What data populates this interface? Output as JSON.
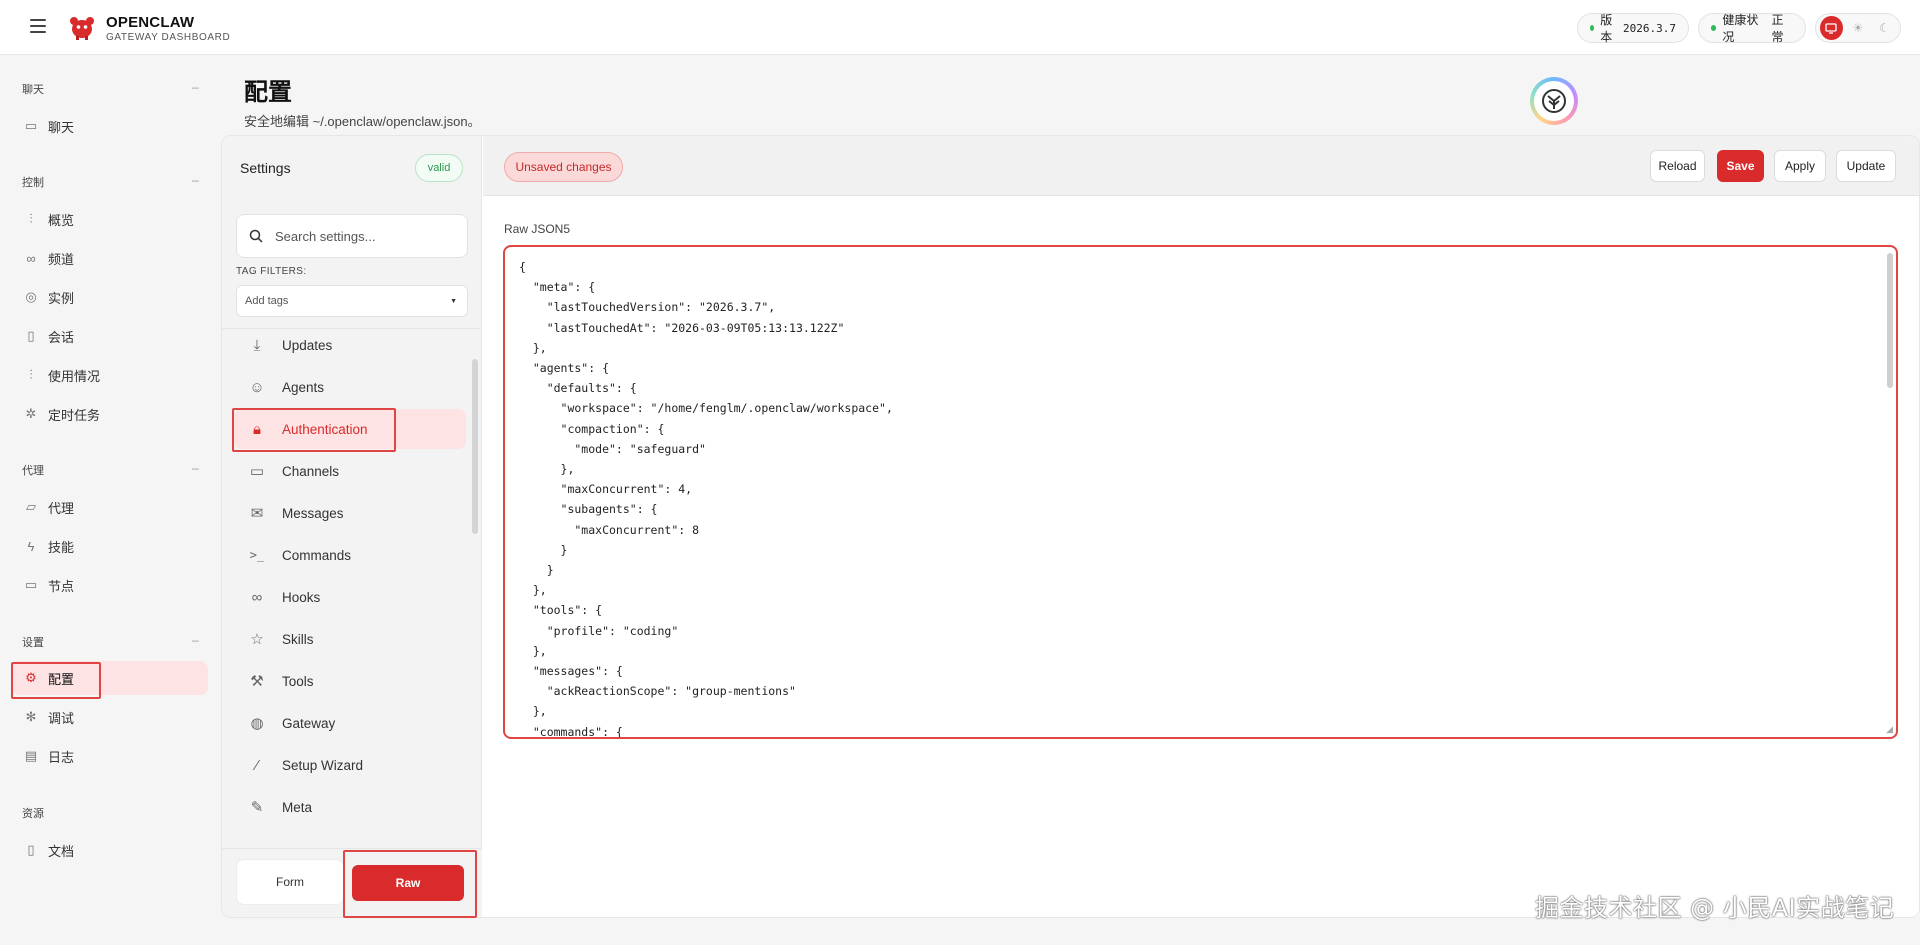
{
  "header": {
    "brand_name": "OPENCLAW",
    "brand_sub": "GATEWAY DASHBOARD",
    "version_label": "版本",
    "version_value": "2026.3.7",
    "health_label": "健康状况",
    "health_value": "正常",
    "status_color": "#2ebc5a",
    "accent_color": "#d92b2b"
  },
  "nav": {
    "sections": [
      {
        "label": "聊天",
        "collapse": "–",
        "items": [
          {
            "label": "聊天",
            "icon": "chat-icon"
          }
        ]
      },
      {
        "label": "控制",
        "collapse": "–",
        "items": [
          {
            "label": "概览",
            "icon": "bar-chart-icon"
          },
          {
            "label": "频道",
            "icon": "link-icon"
          },
          {
            "label": "实例",
            "icon": "broadcast-icon"
          },
          {
            "label": "会话",
            "icon": "document-icon"
          },
          {
            "label": "使用情况",
            "icon": "bar-chart-icon"
          },
          {
            "label": "定时任务",
            "icon": "spinner-icon"
          }
        ]
      },
      {
        "label": "代理",
        "collapse": "–",
        "items": [
          {
            "label": "代理",
            "icon": "folder-icon"
          },
          {
            "label": "技能",
            "icon": "bolt-icon"
          },
          {
            "label": "节点",
            "icon": "monitor-icon"
          }
        ]
      },
      {
        "label": "设置",
        "collapse": "–",
        "items": [
          {
            "label": "配置",
            "icon": "gear-icon",
            "active": true
          },
          {
            "label": "调试",
            "icon": "bug-icon"
          },
          {
            "label": "日志",
            "icon": "log-icon"
          }
        ]
      },
      {
        "label": "资源",
        "items": [
          {
            "label": "文档",
            "icon": "book-icon"
          }
        ]
      }
    ]
  },
  "page": {
    "title": "配置",
    "subtitle": "安全地编辑 ~/.openclaw/openclaw.json。"
  },
  "settings": {
    "title": "Settings",
    "valid_badge": "valid",
    "search_placeholder": "Search settings...",
    "tag_filters_label": "TAG FILTERS:",
    "tag_select_value": "Add tags",
    "categories": [
      {
        "label": "Updates",
        "icon": "download-icon"
      },
      {
        "label": "Agents",
        "icon": "robot-icon"
      },
      {
        "label": "Authentication",
        "icon": "lock-icon",
        "active": true
      },
      {
        "label": "Channels",
        "icon": "chat-icon"
      },
      {
        "label": "Messages",
        "icon": "mail-icon"
      },
      {
        "label": "Commands",
        "icon": "terminal-icon"
      },
      {
        "label": "Hooks",
        "icon": "link-icon"
      },
      {
        "label": "Skills",
        "icon": "star-icon"
      },
      {
        "label": "Tools",
        "icon": "wrench-icon"
      },
      {
        "label": "Gateway",
        "icon": "globe-icon"
      },
      {
        "label": "Setup Wizard",
        "icon": "wand-icon"
      },
      {
        "label": "Meta",
        "icon": "pencil-icon"
      }
    ],
    "mode_form": "Form",
    "mode_raw": "Raw"
  },
  "editor": {
    "unsaved_label": "Unsaved changes",
    "reload": "Reload",
    "save": "Save",
    "apply": "Apply",
    "update": "Update",
    "raw_label": "Raw JSON5",
    "content": "{\n  \"meta\": {\n    \"lastTouchedVersion\": \"2026.3.7\",\n    \"lastTouchedAt\": \"2026-03-09T05:13:13.122Z\"\n  },\n  \"agents\": {\n    \"defaults\": {\n      \"workspace\": \"/home/fenglm/.openclaw/workspace\",\n      \"compaction\": {\n        \"mode\": \"safeguard\"\n      },\n      \"maxConcurrent\": 4,\n      \"subagents\": {\n        \"maxConcurrent\": 8\n      }\n    }\n  },\n  \"tools\": {\n    \"profile\": \"coding\"\n  },\n  \"messages\": {\n    \"ackReactionScope\": \"group-mentions\"\n  },\n  \"commands\": {"
  },
  "watermark": "掘金技术社区 @ 小民AI实战笔记"
}
